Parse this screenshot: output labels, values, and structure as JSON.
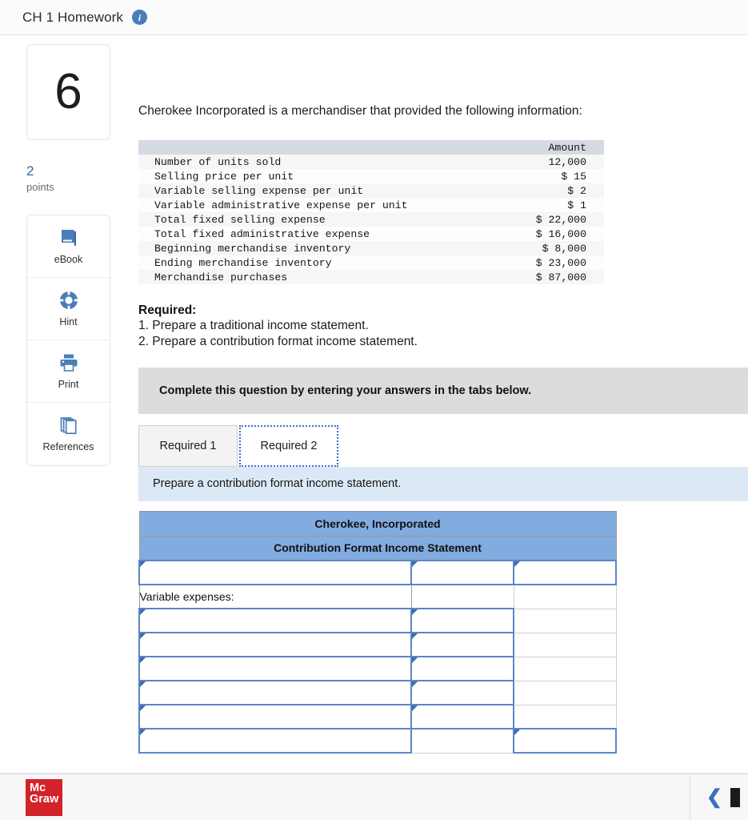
{
  "header": {
    "title": "CH 1 Homework",
    "info_icon": "info-icon"
  },
  "sidebar": {
    "question_number": "6",
    "points_value": "2",
    "points_label": "points",
    "tools": [
      {
        "label": "eBook",
        "icon": "book-icon"
      },
      {
        "label": "Hint",
        "icon": "life-preserver-icon"
      },
      {
        "label": "Print",
        "icon": "printer-icon"
      },
      {
        "label": "References",
        "icon": "copy-pages-icon"
      }
    ]
  },
  "question": {
    "prompt": "Cherokee Incorporated is a merchandiser that provided the following information:",
    "given_table": {
      "header_label": "",
      "header_amount": "Amount",
      "rows": [
        {
          "label": "Number of units sold",
          "amount": "12,000"
        },
        {
          "label": "Selling price per unit",
          "amount": "$ 15"
        },
        {
          "label": "Variable selling expense per unit",
          "amount": "$ 2"
        },
        {
          "label": "Variable administrative expense per unit",
          "amount": "$ 1"
        },
        {
          "label": "Total fixed selling expense",
          "amount": "$ 22,000"
        },
        {
          "label": "Total fixed administrative expense",
          "amount": "$ 16,000"
        },
        {
          "label": "Beginning merchandise inventory",
          "amount": "$ 8,000"
        },
        {
          "label": "Ending merchandise inventory",
          "amount": "$ 23,000"
        },
        {
          "label": "Merchandise purchases",
          "amount": "$ 87,000"
        }
      ]
    },
    "required_heading": "Required:",
    "required_items": [
      "1. Prepare a traditional income statement.",
      "2. Prepare a contribution format income statement."
    ]
  },
  "banner": {
    "text": "Complete this question by entering your answers in the tabs below."
  },
  "tabs": [
    {
      "label": "Required 1",
      "active": false
    },
    {
      "label": "Required 2",
      "active": true
    }
  ],
  "sub_instruction": {
    "text": "Prepare a contribution format income statement."
  },
  "worksheet": {
    "title_row_1": "Cherokee, Incorporated",
    "title_row_2": "Contribution Format Income Statement",
    "rows": [
      {
        "label": "",
        "type": "input",
        "c2": "input",
        "c3": "input"
      },
      {
        "label": "Variable expenses:",
        "type": "text",
        "c2": "blank",
        "c3": "blank"
      },
      {
        "label": "",
        "type": "input",
        "c2": "input",
        "c3": "blank"
      },
      {
        "label": "",
        "type": "input",
        "c2": "input",
        "c3": "blank"
      },
      {
        "label": "",
        "type": "input",
        "c2": "input",
        "c3": "blank"
      },
      {
        "label": "",
        "type": "input",
        "c2": "input",
        "c3": "blank"
      },
      {
        "label": "",
        "type": "input",
        "c2": "input",
        "c3": "blank"
      },
      {
        "label": "",
        "type": "input",
        "c2": "blank",
        "c3": "input"
      }
    ]
  },
  "footer": {
    "logo_line_1": "Mc",
    "logo_line_2": "Graw",
    "prev_icon": "chevron-left-icon",
    "brand_color": "#d32229",
    "accent_color": "#3b6fc4"
  }
}
